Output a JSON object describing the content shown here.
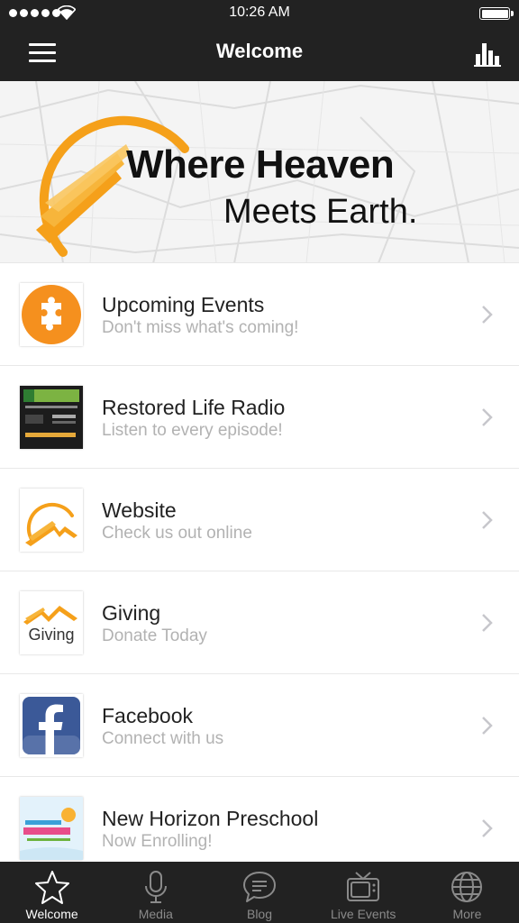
{
  "status_bar": {
    "time": "10:26 AM"
  },
  "nav": {
    "title": "Welcome"
  },
  "banner": {
    "line1": "Where Heaven",
    "line2": "Meets Earth.",
    "accent_color": "#f5a01a"
  },
  "list": [
    {
      "title": "Upcoming Events",
      "subtitle": "Don't miss what's coming!",
      "icon": "puzzle-icon"
    },
    {
      "title": "Restored Life Radio",
      "subtitle": "Listen to every episode!",
      "icon": "radio-thumbnail"
    },
    {
      "title": "Website",
      "subtitle": "Check us out online",
      "icon": "church-logo-icon"
    },
    {
      "title": "Giving",
      "subtitle": "Donate Today",
      "icon": "giving-logo-icon",
      "thumb_text": "Giving"
    },
    {
      "title": "Facebook",
      "subtitle": "Connect with us",
      "icon": "facebook-icon"
    },
    {
      "title": "New Horizon Preschool",
      "subtitle": "Now Enrolling!",
      "icon": "preschool-logo"
    }
  ],
  "tabs": [
    {
      "label": "Welcome",
      "icon": "star-icon",
      "active": true
    },
    {
      "label": "Media",
      "icon": "microphone-icon",
      "active": false
    },
    {
      "label": "Blog",
      "icon": "speech-bubble-icon",
      "active": false
    },
    {
      "label": "Live Events",
      "icon": "tv-icon",
      "active": false
    },
    {
      "label": "More",
      "icon": "globe-icon",
      "active": false
    }
  ],
  "colors": {
    "bar_background": "#222222",
    "accent_orange": "#f5a01a",
    "subtitle_gray": "#b2b2b2",
    "facebook_blue": "#3b5998"
  }
}
